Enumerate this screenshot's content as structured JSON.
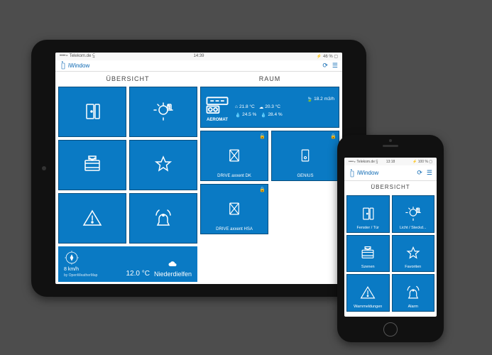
{
  "app": {
    "name": "iWindow"
  },
  "ipad": {
    "status": {
      "carrier": "••••∘ Telekom.de ⥹",
      "time": "14:39",
      "right": "⚡ 46 % ▢"
    },
    "sections": {
      "overview": {
        "title": "ÜBERSICHT",
        "tiles": [
          {
            "id": "door",
            "label": ""
          },
          {
            "id": "light",
            "label": ""
          },
          {
            "id": "scenes",
            "label": ""
          },
          {
            "id": "favorites",
            "label": ""
          },
          {
            "id": "alerts",
            "label": ""
          },
          {
            "id": "alarm",
            "label": ""
          }
        ],
        "weather": {
          "wind_speed": "8 km/h",
          "credit": "by OpenWeatherMap",
          "temp": "12.0 °C",
          "location": "Niederdielfen"
        }
      },
      "room": {
        "title": "RAUM",
        "aeromat": {
          "label": "AEROMAT",
          "readings": {
            "flow": "18.2 m3/h",
            "t_out": "21.8 °C",
            "t_in": "20.3 °C",
            "h_out": "24.5 %",
            "h_in": "28.4 %"
          }
        },
        "tiles": [
          {
            "id": "drive-dk",
            "label": "DRIVE axxent DK"
          },
          {
            "id": "genius",
            "label": "GENIUS"
          },
          {
            "id": "drive-hsa",
            "label": "DRIVE axxent HSA"
          }
        ]
      }
    }
  },
  "iphone": {
    "status": {
      "carrier": "••••∘ Telekom.de ⥹",
      "time": "13:18",
      "right": "⚡ 100 % ▢"
    },
    "title": "ÜBERSICHT",
    "tiles": [
      {
        "id": "door",
        "label": "Fenster / Tür"
      },
      {
        "id": "light",
        "label": "Licht / Steckd..."
      },
      {
        "id": "scenes",
        "label": "Szenen"
      },
      {
        "id": "favorites",
        "label": "Favoriten"
      },
      {
        "id": "alerts",
        "label": "Warnmeldungen"
      },
      {
        "id": "alarm",
        "label": "Alarm"
      }
    ]
  }
}
